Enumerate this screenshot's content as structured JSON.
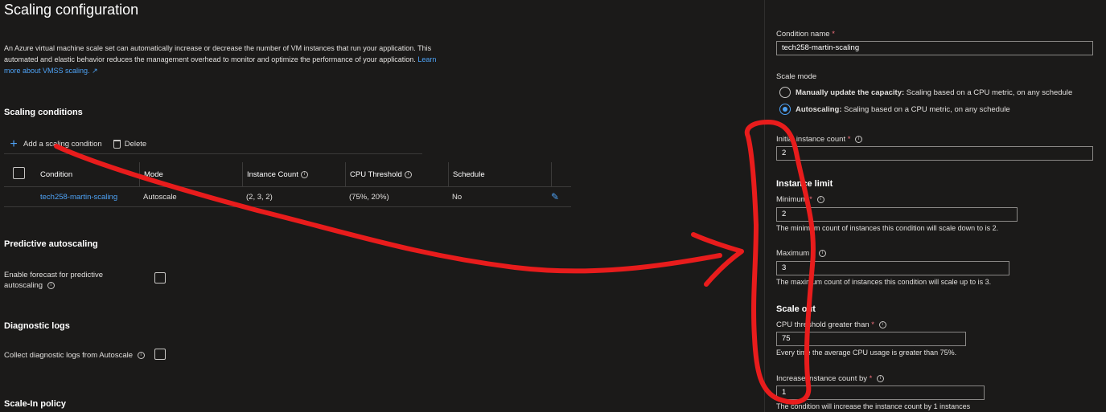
{
  "page": {
    "title": "Scaling configuration",
    "description": "An Azure virtual machine scale set can automatically increase or decrease the number of VM instances that run your application. This automated and elastic behavior reduces the management overhead to monitor and optimize the performance of your application.",
    "learn_more": "Learn more about VMSS scaling."
  },
  "scaling_conditions": {
    "heading": "Scaling conditions",
    "add_label": "Add a scaling condition",
    "delete_label": "Delete",
    "columns": [
      "Condition",
      "Mode",
      "Instance Count",
      "CPU Threshold",
      "Schedule"
    ],
    "rows": [
      {
        "condition": "tech258-martin-scaling",
        "mode": "Autoscale",
        "instance_count": "(2, 3, 2)",
        "cpu_threshold": "(75%, 20%)",
        "schedule": "No"
      }
    ]
  },
  "predictive": {
    "heading": "Predictive autoscaling",
    "label_line1": "Enable forecast for predictive",
    "label_line2": "autoscaling"
  },
  "diagnostic": {
    "heading": "Diagnostic logs",
    "label": "Collect diagnostic logs from Autoscale"
  },
  "scale_in": {
    "heading": "Scale-In policy"
  },
  "panel": {
    "title_remnant": "g",
    "condition_name_label": "Condition name",
    "condition_name_value": "tech258-martin-scaling",
    "scale_mode_label": "Scale mode",
    "manual_bold": "Manually update the capacity:",
    "manual_rest": " Scaling based on a CPU metric, on any schedule",
    "auto_bold": "Autoscaling:",
    "auto_rest": " Scaling based on a CPU metric, on any schedule",
    "initial_label": "Initial instance count",
    "initial_value": "2",
    "instance_limit_heading": "Instance limit",
    "minimum_label": "Minimum",
    "minimum_value": "2",
    "minimum_help": "The minimum count of instances this condition will scale down to is 2.",
    "maximum_label": "Maximum",
    "maximum_value": "3",
    "maximum_help": "The maximum count of instances this condition will scale up to is 3.",
    "scale_out_heading": "Scale out",
    "cpu_gt_label": "CPU threshold greater than",
    "cpu_gt_value": "75",
    "cpu_gt_help": "Every time the average CPU usage is greater than 75%.",
    "increase_label": "Increase instance count by",
    "increase_value": "1",
    "increase_help": "The condition will increase the instance count by 1 instances"
  },
  "colors": {
    "background": "#1b1a19",
    "accent": "#4ea2f5",
    "required": "#f1707b",
    "annotation": "#e81c1c"
  }
}
